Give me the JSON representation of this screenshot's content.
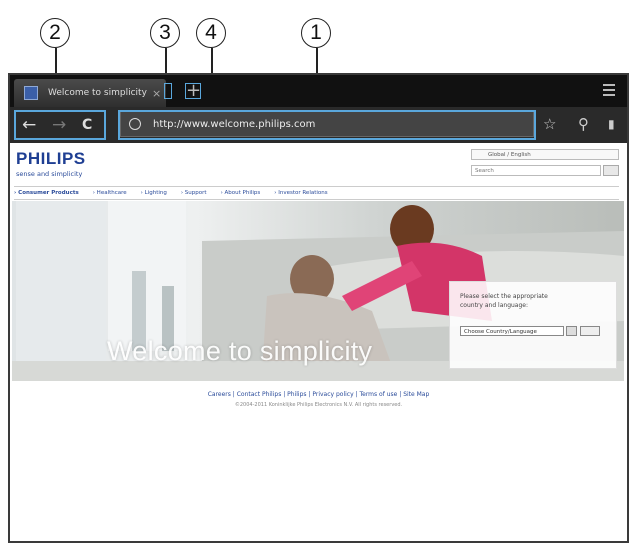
{
  "callouts": [
    "2",
    "3",
    "4",
    "1"
  ],
  "browser": {
    "tab_title": "Welcome to simplicity ...",
    "tab_close": "×",
    "new_tab": "+",
    "url": "http://www.welcome.philips.com",
    "back": "←",
    "forward": "→",
    "reload": "C",
    "star": "☆",
    "search": "⚲",
    "bookmark": "▮"
  },
  "page": {
    "logo": "PHILIPS",
    "tagline": "sense and simplicity",
    "locale": "Global / English",
    "search_placeholder": "Search",
    "nav": [
      "› Consumer Products",
      "› Healthcare",
      "› Lighting",
      "› Support",
      "› About Philips",
      "› Investor Relations"
    ],
    "hero_title": "Welcome to simplicity",
    "country_prompt": "Please select the appropriate country and language:",
    "country_select": "Choose Country/Language",
    "footer_links": "Careers | Contact Philips | Philips | Privacy policy | Terms of use | Site Map",
    "footer_copy": "©2004-2011 Koninklijke Philips Electronics N.V. All rights reserved."
  },
  "colors": {
    "highlight": "#5aa7dc",
    "brand": "#1f3f93",
    "toolbar": "#2a2a2a"
  }
}
